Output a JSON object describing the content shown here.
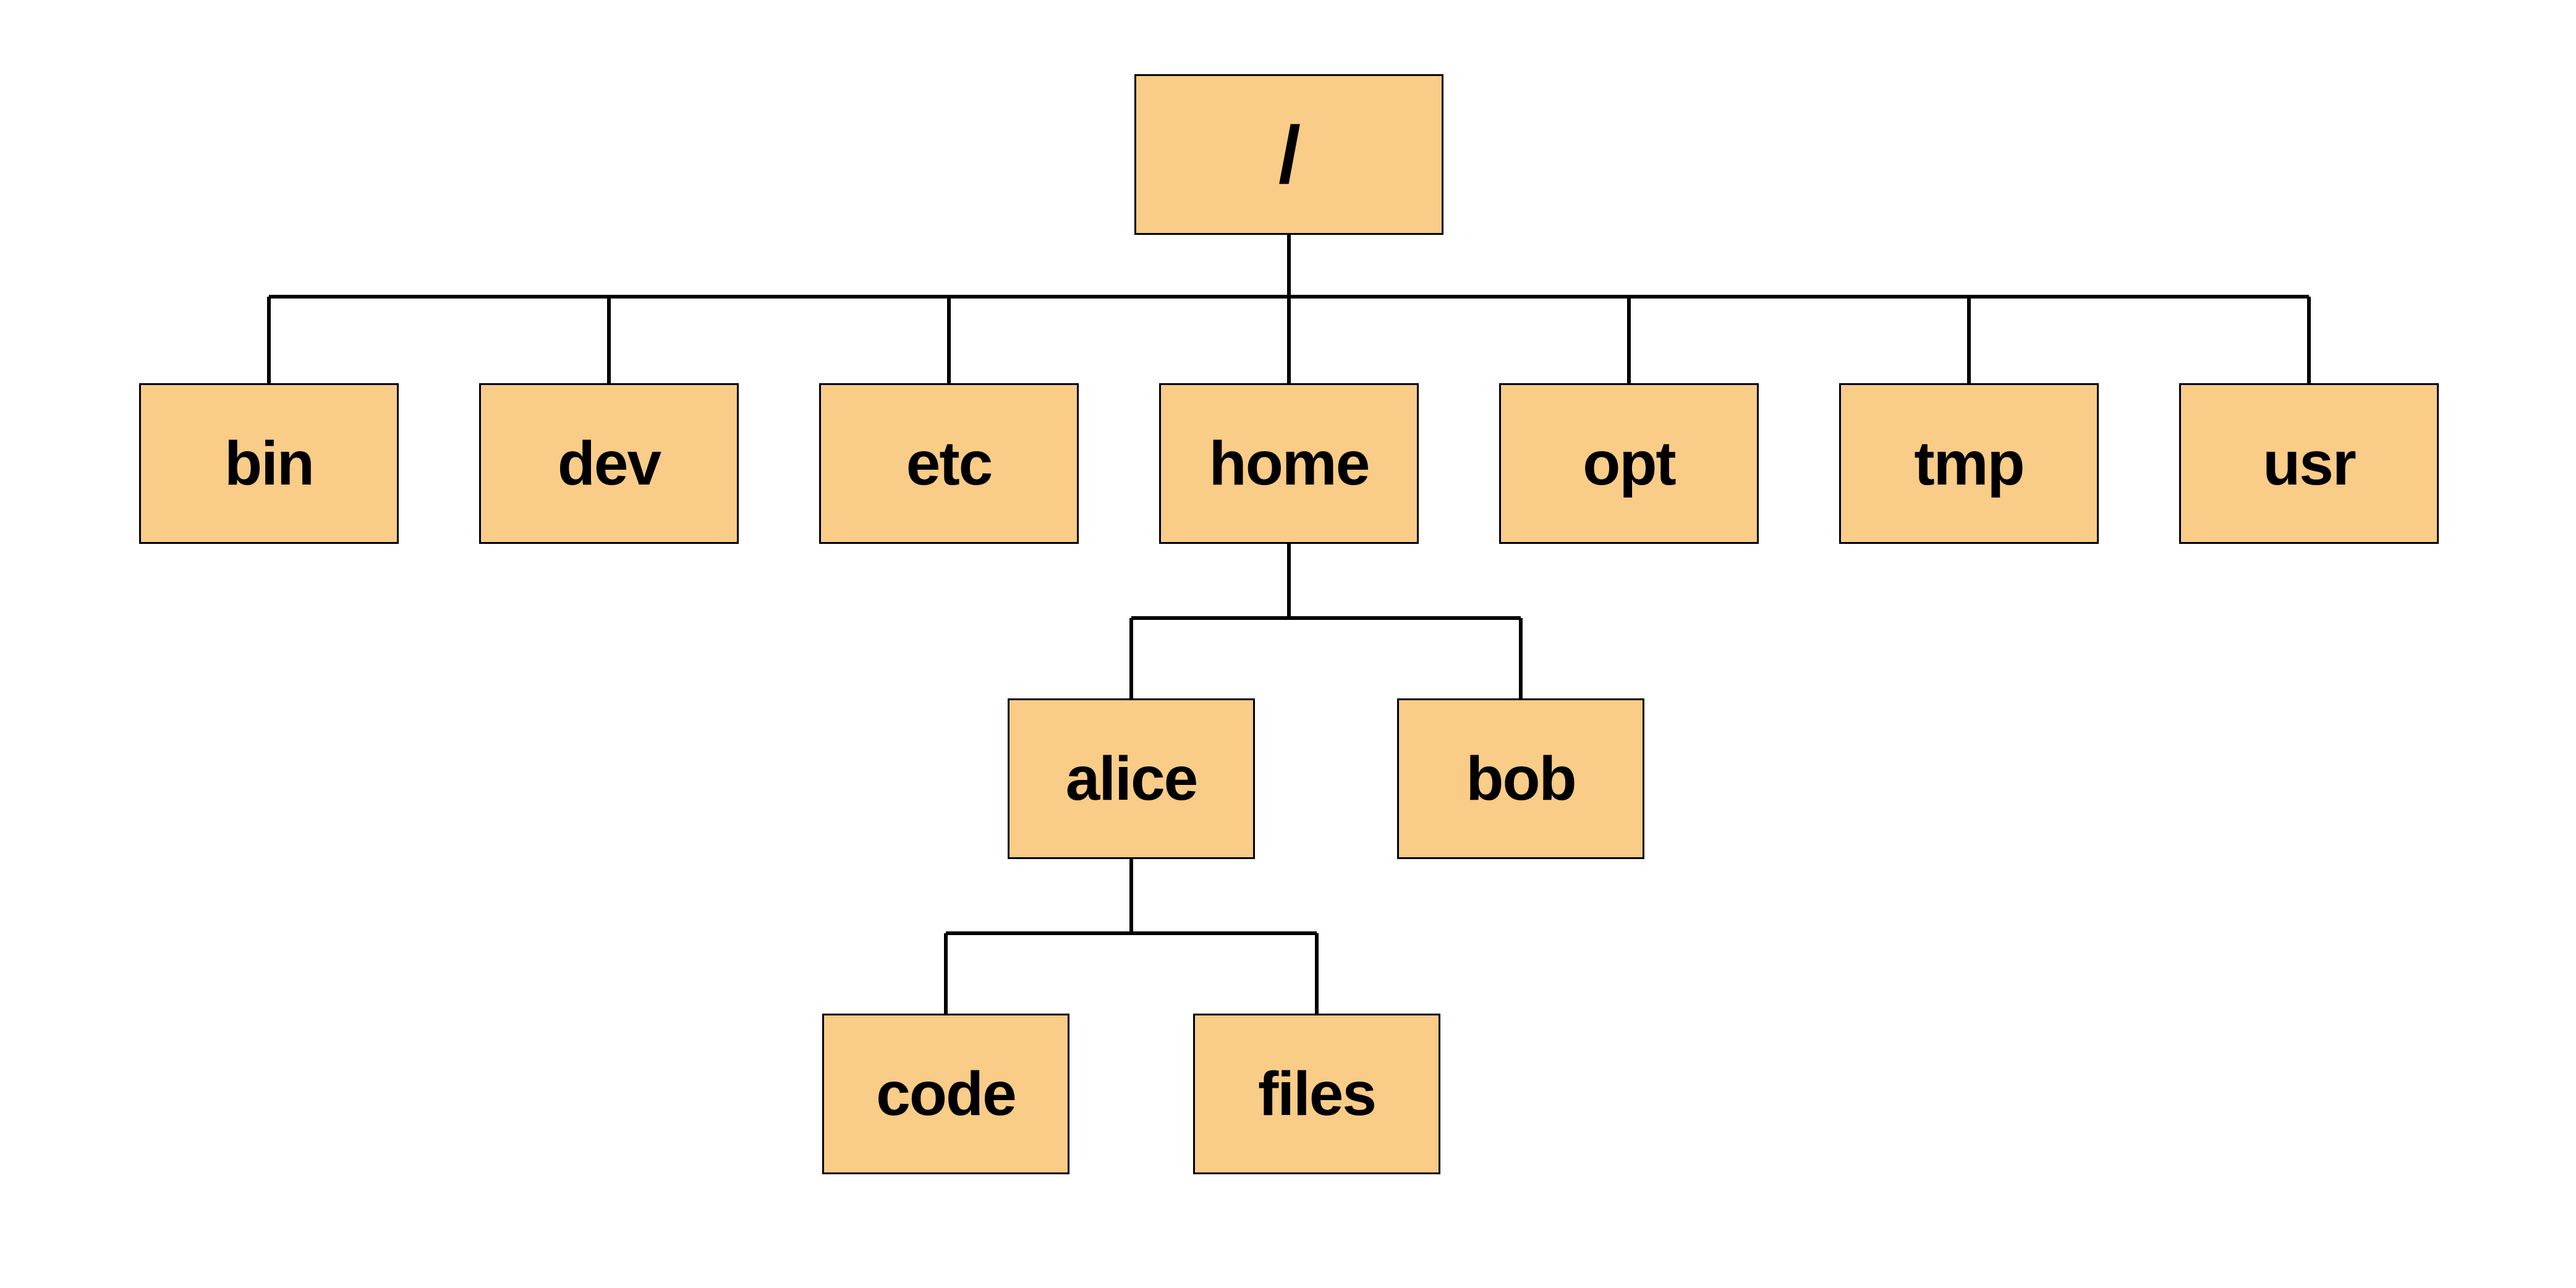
{
  "tree": {
    "root": {
      "label": "/"
    },
    "level1": [
      {
        "label": "bin"
      },
      {
        "label": "dev"
      },
      {
        "label": "etc"
      },
      {
        "label": "home"
      },
      {
        "label": "opt"
      },
      {
        "label": "tmp"
      },
      {
        "label": "usr"
      }
    ],
    "level2": [
      {
        "label": "alice"
      },
      {
        "label": "bob"
      }
    ],
    "level3": [
      {
        "label": "code"
      },
      {
        "label": "files"
      }
    ]
  },
  "colors": {
    "nodeFill": "#f9cc87",
    "nodeBorder": "#000000",
    "connector": "#000000"
  }
}
